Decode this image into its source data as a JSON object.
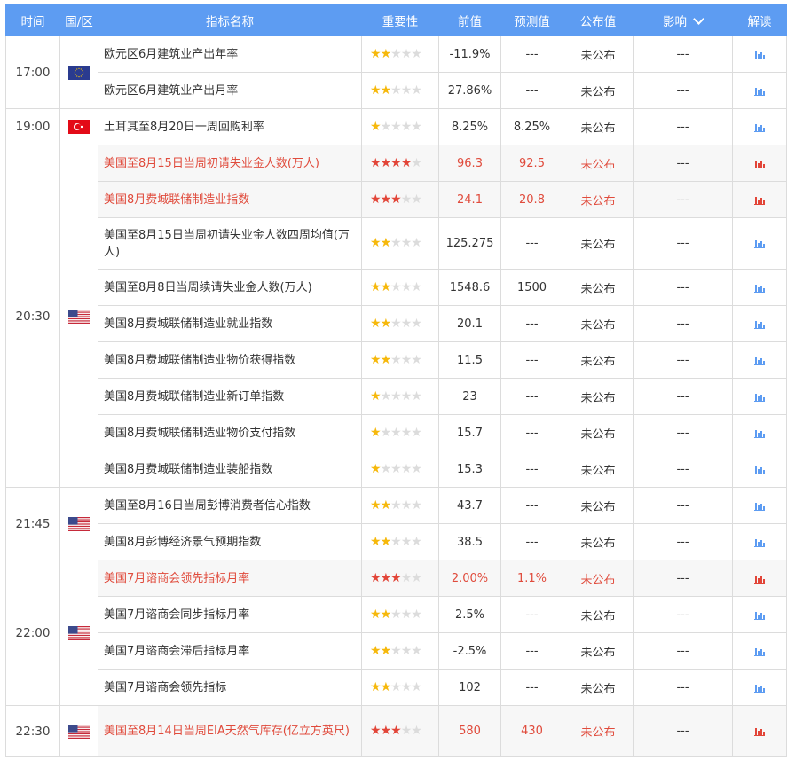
{
  "header": {
    "time": "时间",
    "country": "国/区",
    "name": "指标名称",
    "importance": "重要性",
    "previous": "前值",
    "forecast": "预测值",
    "published": "公布值",
    "impact": "影响",
    "interpret": "解读"
  },
  "colors": {
    "header_bg": "#5d9cf2",
    "important_text": "#e04b3c",
    "star_on": "#f6b80b",
    "star_red": "#e24538"
  },
  "groups": [
    {
      "time": "17:00",
      "flag": "eu-flag",
      "rows": [
        {
          "name": "欧元区6月建筑业产出年率",
          "stars": 2,
          "important": false,
          "previous": "-11.9%",
          "forecast": "---",
          "published": "未公布",
          "impact": "---"
        },
        {
          "name": "欧元区6月建筑业产出月率",
          "stars": 2,
          "important": false,
          "previous": "27.86%",
          "forecast": "---",
          "published": "未公布",
          "impact": "---"
        }
      ]
    },
    {
      "time": "19:00",
      "flag": "tr-flag",
      "rows": [
        {
          "name": "土耳其至8月20日一周回购利率",
          "stars": 1,
          "important": false,
          "previous": "8.25%",
          "forecast": "8.25%",
          "published": "未公布",
          "impact": "---"
        }
      ]
    },
    {
      "time": "20:30",
      "flag": "us-flag",
      "rows": [
        {
          "name": "美国至8月15日当周初请失业金人数(万人)",
          "stars": 4,
          "important": true,
          "previous": "96.3",
          "forecast": "92.5",
          "published": "未公布",
          "impact": "---"
        },
        {
          "name": "美国8月费城联储制造业指数",
          "stars": 3,
          "important": true,
          "previous": "24.1",
          "forecast": "20.8",
          "published": "未公布",
          "impact": "---"
        },
        {
          "name": "美国至8月15日当周初请失业金人数四周均值(万人)",
          "stars": 2,
          "important": false,
          "previous": "125.275",
          "forecast": "---",
          "published": "未公布",
          "impact": "---"
        },
        {
          "name": "美国至8月8日当周续请失业金人数(万人)",
          "stars": 2,
          "important": false,
          "previous": "1548.6",
          "forecast": "1500",
          "published": "未公布",
          "impact": "---"
        },
        {
          "name": "美国8月费城联储制造业就业指数",
          "stars": 2,
          "important": false,
          "previous": "20.1",
          "forecast": "---",
          "published": "未公布",
          "impact": "---"
        },
        {
          "name": "美国8月费城联储制造业物价获得指数",
          "stars": 2,
          "important": false,
          "previous": "11.5",
          "forecast": "---",
          "published": "未公布",
          "impact": "---"
        },
        {
          "name": "美国8月费城联储制造业新订单指数",
          "stars": 1,
          "important": false,
          "previous": "23",
          "forecast": "---",
          "published": "未公布",
          "impact": "---"
        },
        {
          "name": "美国8月费城联储制造业物价支付指数",
          "stars": 1,
          "important": false,
          "previous": "15.7",
          "forecast": "---",
          "published": "未公布",
          "impact": "---"
        },
        {
          "name": "美国8月费城联储制造业装船指数",
          "stars": 1,
          "important": false,
          "previous": "15.3",
          "forecast": "---",
          "published": "未公布",
          "impact": "---"
        }
      ]
    },
    {
      "time": "21:45",
      "flag": "us-flag",
      "rows": [
        {
          "name": "美国至8月16日当周彭博消费者信心指数",
          "stars": 2,
          "important": false,
          "previous": "43.7",
          "forecast": "---",
          "published": "未公布",
          "impact": "---"
        },
        {
          "name": "美国8月彭博经济景气预期指数",
          "stars": 2,
          "important": false,
          "previous": "38.5",
          "forecast": "---",
          "published": "未公布",
          "impact": "---"
        }
      ]
    },
    {
      "time": "22:00",
      "flag": "us-flag",
      "rows": [
        {
          "name": "美国7月谘商会领先指标月率",
          "stars": 3,
          "important": true,
          "previous": "2.00%",
          "forecast": "1.1%",
          "published": "未公布",
          "impact": "---"
        },
        {
          "name": "美国7月谘商会同步指标月率",
          "stars": 2,
          "important": false,
          "previous": "2.5%",
          "forecast": "---",
          "published": "未公布",
          "impact": "---"
        },
        {
          "name": "美国7月谘商会滞后指标月率",
          "stars": 2,
          "important": false,
          "previous": "-2.5%",
          "forecast": "---",
          "published": "未公布",
          "impact": "---"
        },
        {
          "name": "美国7月谘商会领先指标",
          "stars": 2,
          "important": false,
          "previous": "102",
          "forecast": "---",
          "published": "未公布",
          "impact": "---"
        }
      ]
    },
    {
      "time": "22:30",
      "flag": "us-flag",
      "rows": [
        {
          "name": "美国至8月14日当周EIA天然气库存(亿立方英尺)",
          "stars": 3,
          "important": true,
          "previous": "580",
          "forecast": "430",
          "published": "未公布",
          "impact": "---"
        }
      ]
    }
  ]
}
